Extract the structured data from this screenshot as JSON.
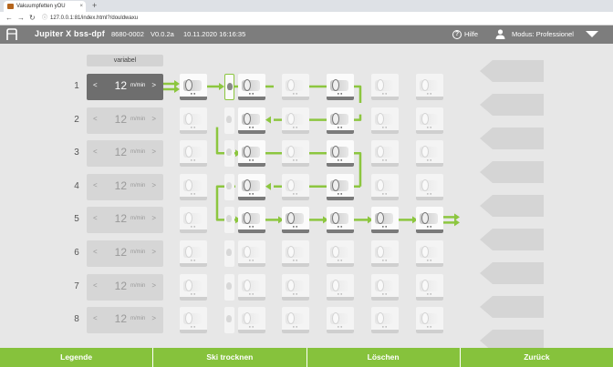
{
  "browser": {
    "tab_title": "Vakuumpfetten yOU",
    "tab_close": "×",
    "new_tab": "+",
    "url": "127.0.0.1:81/index.html?/douldwaxu"
  },
  "header": {
    "title": "Jupiter X bss-dpf",
    "serial": "8680-0002",
    "version": "V0.0.2a",
    "datetime": "10.11.2020 16:16:35",
    "help": "Hilfe",
    "mode": "Modus: Professionel"
  },
  "grid": {
    "column_label": "variabel",
    "rows": [
      {
        "num": "1",
        "speed": "12",
        "unit": "m/min",
        "prev": "<",
        "next": ">"
      },
      {
        "num": "2",
        "speed": "12",
        "unit": "m/min",
        "prev": "<",
        "next": ">"
      },
      {
        "num": "3",
        "speed": "12",
        "unit": "m/min",
        "prev": "<",
        "next": ">"
      },
      {
        "num": "4",
        "speed": "12",
        "unit": "m/min",
        "prev": "<",
        "next": ">"
      },
      {
        "num": "5",
        "speed": "12",
        "unit": "m/min",
        "prev": "<",
        "next": ">"
      },
      {
        "num": "6",
        "speed": "12",
        "unit": "m/min",
        "prev": "<",
        "next": ">"
      },
      {
        "num": "7",
        "speed": "12",
        "unit": "m/min",
        "prev": "<",
        "next": ">"
      },
      {
        "num": "8",
        "speed": "12",
        "unit": "m/min",
        "prev": "<",
        "next": ">"
      }
    ],
    "active_row": "1",
    "flow_color": "#8cc63f"
  },
  "footer": {
    "legend": "Legende",
    "dry": "Ski trocknen",
    "delete": "Löschen",
    "back": "Zurück"
  },
  "colors": {
    "accent": "#8cc63f",
    "header_bg": "#7d7d7d",
    "active_speed_bg": "#6e6e6e"
  }
}
